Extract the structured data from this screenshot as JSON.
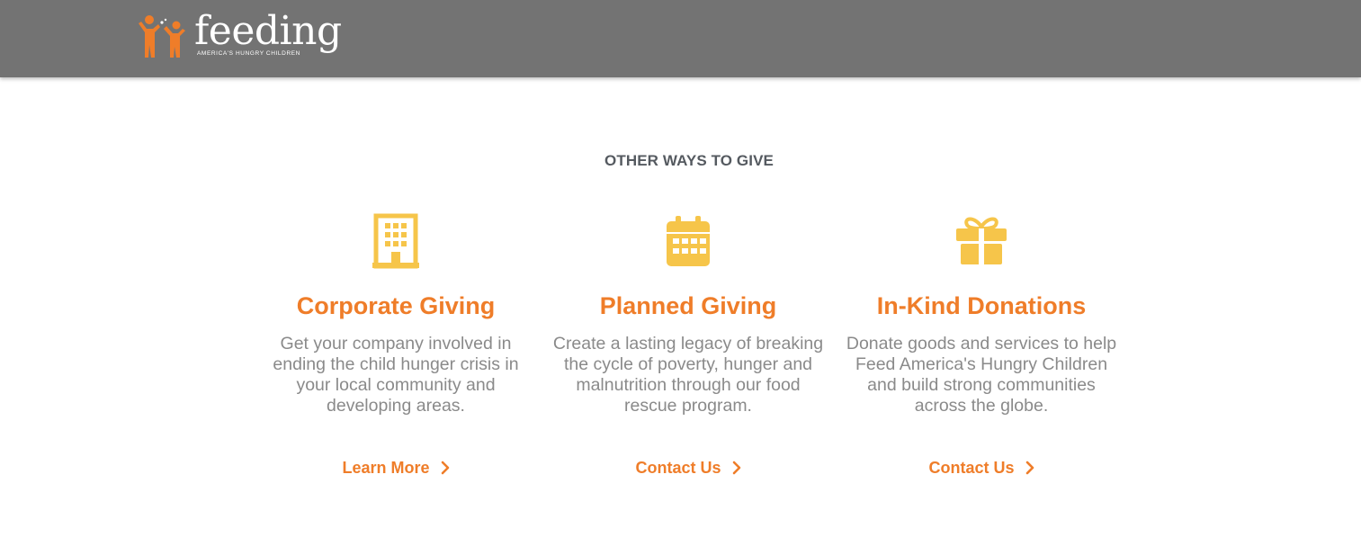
{
  "header": {
    "logo": {
      "word": "feeding",
      "tagline": "AMERICA'S HUNGRY CHILDREN",
      "icon": "two-children-figures-icon"
    },
    "background_color": "#737373"
  },
  "section": {
    "title": "OTHER WAYS TO GIVE"
  },
  "cards": [
    {
      "icon": "building-icon",
      "title": "Corporate Giving",
      "text": "Get your company involved in ending the child hunger crisis in your local community and developing areas.",
      "link_label": "Learn More"
    },
    {
      "icon": "calendar-icon",
      "title": "Planned Giving",
      "text": "Create a lasting legacy of breaking the cycle of poverty, hunger and malnutrition through our food rescue program.",
      "link_label": "Contact Us"
    },
    {
      "icon": "gift-icon",
      "title": "In-Kind Donations",
      "text": "Donate goods and services to help Feed America's Hungry Children and build strong communities across the globe.",
      "link_label": "Contact Us"
    }
  ],
  "colors": {
    "accent_orange": "#ef7d29",
    "icon_yellow": "#f6c54a",
    "body_text": "#8a8a8a",
    "heading_text": "#555a60"
  }
}
